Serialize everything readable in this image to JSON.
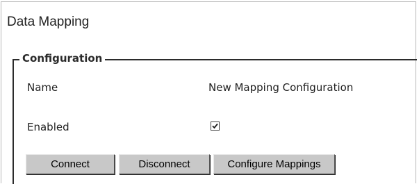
{
  "panel": {
    "title": "Data Mapping"
  },
  "configuration": {
    "legend": "Configuration",
    "fields": {
      "name": {
        "label": "Name",
        "value": "New Mapping Configuration"
      },
      "enabled": {
        "label": "Enabled",
        "checked": true
      }
    }
  },
  "buttons": {
    "connect_label": "Connect",
    "disconnect_label": "Disconnect",
    "configure_label": "Configure Mappings"
  },
  "colors": {
    "button_face": "#c8c8c8",
    "section_line": "#2b2b2b",
    "panel_border": "#b5b5b5"
  }
}
